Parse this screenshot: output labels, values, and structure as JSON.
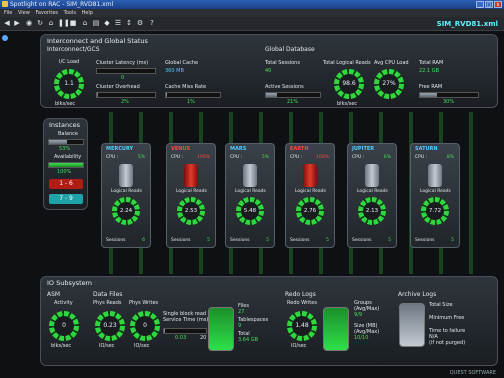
{
  "window": {
    "title": "Spotlight on RAC - SIM_RVD81.xml"
  },
  "menu": [
    "File",
    "View",
    "Favorites",
    "Tools",
    "Help"
  ],
  "connection_title": "SIM_RVD81.xml",
  "colors": {
    "accent_green": "#2fd63f",
    "accent_cyan": "#5ff2ff",
    "alarm_red": "#e23b2b"
  },
  "top_panel": {
    "title": "Interconnect and Global Status",
    "interconnect": {
      "title": "Interconnect/GCS",
      "io_load_label": "I/C Load",
      "io_load_value": "1.1",
      "io_load_unit": "blks/sec",
      "cluster_latency_label": "Cluster Latency (ms)",
      "cluster_latency_value": "0",
      "cluster_overhead_label": "Cluster Overhead",
      "cluster_overhead_value": "2%",
      "global_cache_label": "Global Cache",
      "global_cache_value": "360 MB",
      "cache_miss_label": "Cache Miss Rate",
      "cache_miss_value": "1%"
    },
    "global_db": {
      "title": "Global Database",
      "total_sessions_label": "Total Sessions",
      "total_sessions_value": "40",
      "active_sessions_label": "Active Sessions",
      "active_sessions_value": "21%",
      "logical_reads_label": "Total Logical Reads",
      "logical_reads_value": "98.6",
      "logical_reads_unit": "blks/sec",
      "avg_cpu_label": "Avg CPU Load",
      "avg_cpu_value": "27%",
      "total_ram_label": "Total RAM",
      "total_ram_value": "22.1 GB",
      "free_ram_label": "Free RAM",
      "free_ram_value": "30%"
    }
  },
  "instances_panel": {
    "title": "Instances",
    "balance_label": "Balance",
    "balance_value": "53%",
    "availability_label": "Availability",
    "availability_value": "100%",
    "badge_down": "1 - 6",
    "badge_up": "7 - 9"
  },
  "instances": [
    {
      "name": "MERCURY",
      "cpu_label": "CPU :",
      "cpu": "5%",
      "lr_label": "Logical Reads",
      "lr": "2.24",
      "sess_label": "Sessions",
      "sessions": "6",
      "down": false
    },
    {
      "name": "VENUS",
      "cpu_label": "CPU :",
      "cpu": "100%",
      "lr_label": "Logical Reads",
      "lr": "2.53",
      "sess_label": "Sessions",
      "sessions": "5",
      "down": true
    },
    {
      "name": "MARS",
      "cpu_label": "CPU :",
      "cpu": "5%",
      "lr_label": "Logical Reads",
      "lr": "5.48",
      "sess_label": "Sessions",
      "sessions": "5",
      "down": false
    },
    {
      "name": "EARTH",
      "cpu_label": "CPU :",
      "cpu": "100%",
      "lr_label": "Logical Reads",
      "lr": "2.76",
      "sess_label": "Sessions",
      "sessions": "5",
      "down": true
    },
    {
      "name": "JUPITER",
      "cpu_label": "CPU :",
      "cpu": "6%",
      "lr_label": "Logical Reads",
      "lr": "2.13",
      "sess_label": "Sessions",
      "sessions": "5",
      "down": false
    },
    {
      "name": "SATURN",
      "cpu_label": "CPU :",
      "cpu": "8%",
      "lr_label": "Logical Reads",
      "lr": "7.72",
      "sess_label": "Sessions",
      "sessions": "5",
      "down": false
    }
  ],
  "io_panel": {
    "title": "IO Subsystem",
    "asm": {
      "title": "ASM",
      "activity_label": "Activity",
      "value": "0",
      "unit": "blks/sec"
    },
    "datafiles": {
      "title": "Data Files",
      "phys_reads_label": "Phys Reads",
      "phys_reads_value": "0.23",
      "phys_reads_unit": "IO/sec",
      "phys_writes_label": "Phys Writes",
      "phys_writes_value": "0",
      "phys_writes_unit": "IO/sec",
      "single_block_label": "Single block read Service Time (ms)",
      "single_block_value": "0.03",
      "single_block_max": "20",
      "files_label": "Files",
      "files_value": "27",
      "tablespaces_label": "Tablespaces",
      "tablespaces_value": "9",
      "total_label": "Total",
      "total_value": "3.64 GB"
    },
    "redo": {
      "title": "Redo Logs",
      "redo_writes_label": "Redo Writes",
      "redo_writes_value": "1.48",
      "redo_writes_unit": "IO/sec",
      "groups_label": "Groups",
      "groups_sub": "(Avg/Max)",
      "groups_value": "9/9",
      "size_label": "Size (MB)",
      "size_sub": "(Avg/Max)",
      "size_value": "10/10"
    },
    "archive": {
      "title": "Archive Logs",
      "total_size_label": "Total Size",
      "min_free_label": "Minimum Free",
      "ttf_label": "Time to failure",
      "ttf_value": "N/A",
      "ttf_note": "(if not purged)"
    }
  },
  "logo_text": "QUEST SOFTWARE"
}
